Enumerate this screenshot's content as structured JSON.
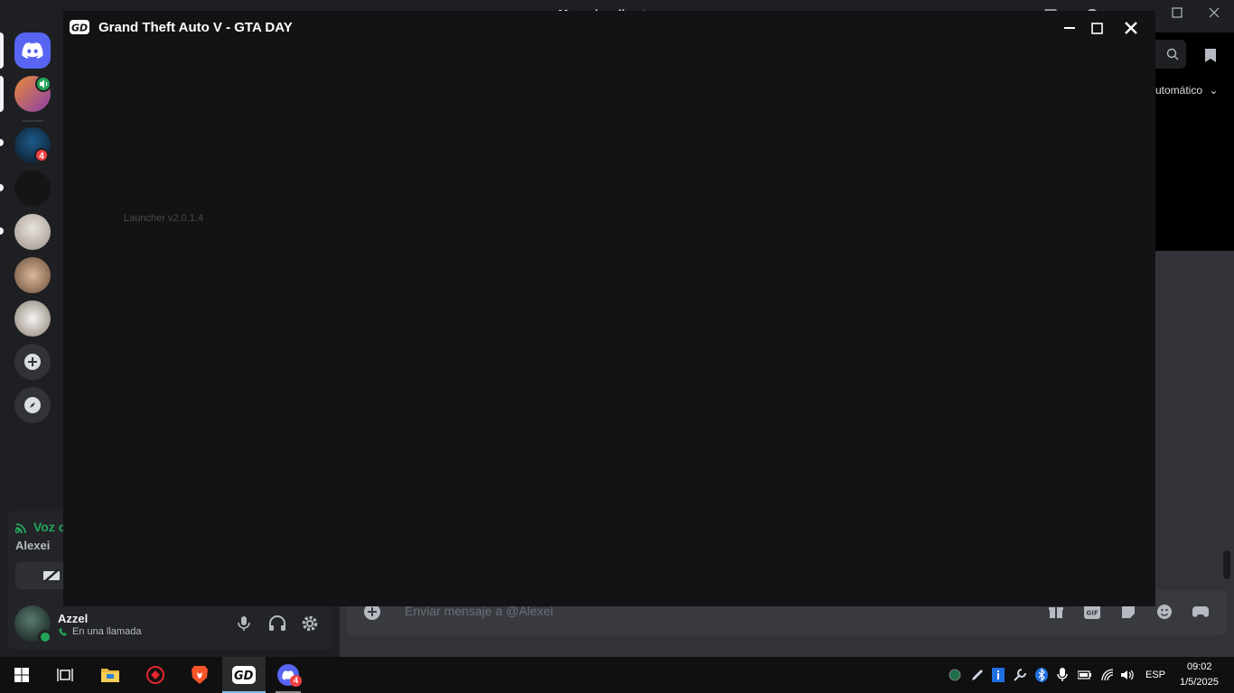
{
  "discord": {
    "top_title": "Mensajes directos",
    "quality_label": "utomático",
    "voice": {
      "status": "Voz c",
      "channel": "Alexei"
    },
    "user": {
      "name": "Azzel",
      "status": "En una llamada"
    },
    "message_placeholder": "Enviar mensaje a @Alexei",
    "guilds": [
      {
        "name": "discord-home",
        "badge": ""
      },
      {
        "name": "guild-voice",
        "badge": ""
      },
      {
        "name": "guild-blue",
        "badge": "4"
      },
      {
        "name": "guild-dark",
        "badge": ""
      },
      {
        "name": "guild-bald",
        "badge": ""
      },
      {
        "name": "guild-hamster",
        "badge": ""
      },
      {
        "name": "guild-cat",
        "badge": ""
      }
    ],
    "colors": {
      "accent": "#5865f2",
      "online": "#23a55a",
      "badge": "#f23f43"
    }
  },
  "launcher": {
    "title": "Grand Theft Auto V - GTA DAY",
    "version": "Launcher v2.0.1.4"
  },
  "taskbar": {
    "apps": [
      "windows-start",
      "task-view",
      "file-explorer",
      "antivirus",
      "brave",
      "gta-day-launcher",
      "discord"
    ],
    "discord_badge": "4",
    "language": "ESP",
    "time": "09:02",
    "date": "1/5/2025"
  }
}
